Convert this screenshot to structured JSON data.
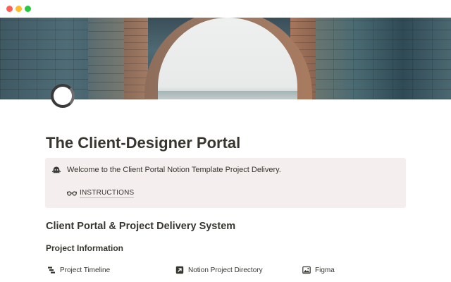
{
  "window": {
    "controls": [
      "close",
      "minimize",
      "zoom"
    ]
  },
  "cover": {
    "description_icon": "cover-image"
  },
  "page": {
    "icon": "ring-icon",
    "title": "The Client-Designer Portal"
  },
  "callout": {
    "icon": "ghost-icon",
    "text": "Welcome to the Client Portal Notion Template Project Delivery.",
    "link": {
      "icon": "glasses-icon",
      "label": "INSTRUCTIONS"
    },
    "background": "#f4eeee"
  },
  "sections": {
    "heading": "Client Portal & Project Delivery System",
    "subheading": "Project Information"
  },
  "links": [
    {
      "icon": "timeline-icon",
      "label": "Project Timeline"
    },
    {
      "icon": "arrow-link-icon",
      "label": "Notion Project Directory"
    },
    {
      "icon": "image-icon",
      "label": "Figma"
    }
  ]
}
